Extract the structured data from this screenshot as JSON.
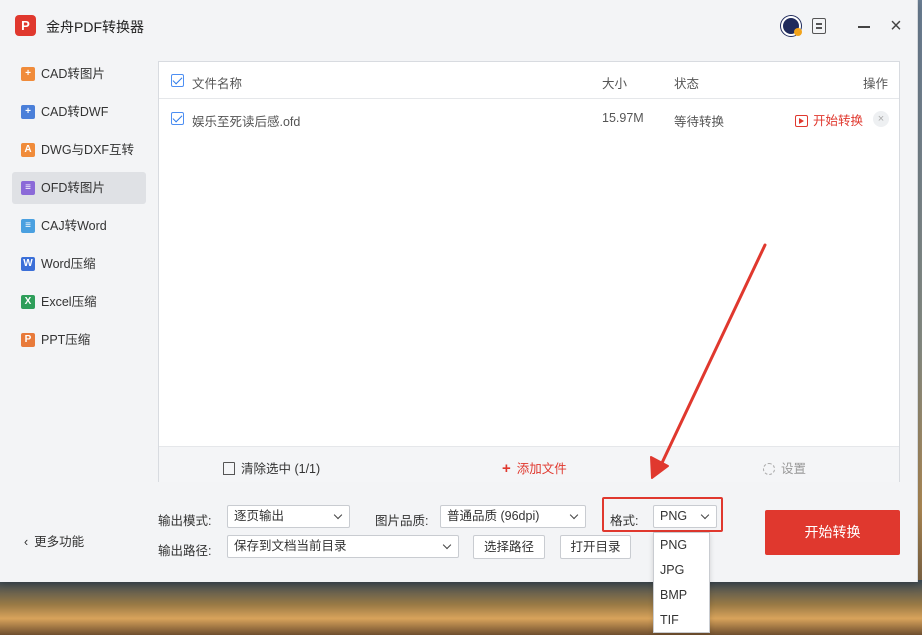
{
  "app": {
    "logo": "P",
    "title": "金舟PDF转换器"
  },
  "sidebar": {
    "items": [
      {
        "label": "CAD转图片",
        "icon": "cad-image-icon",
        "color": "#f08b3a",
        "glyph": "+"
      },
      {
        "label": "CAD转DWF",
        "icon": "cad-dwf-icon",
        "color": "#4a7fd9",
        "glyph": "+"
      },
      {
        "label": "DWG与DXF互转",
        "icon": "dwg-dxf-icon",
        "color": "#f08b3a",
        "glyph": "A"
      },
      {
        "label": "OFD转图片",
        "icon": "ofd-image-icon",
        "color": "#8b6ad8",
        "glyph": "≡"
      },
      {
        "label": "CAJ转Word",
        "icon": "caj-word-icon",
        "color": "#4aa0e0",
        "glyph": "≡"
      },
      {
        "label": "Word压缩",
        "icon": "word-compress-icon",
        "color": "#3b6fd8",
        "glyph": "W"
      },
      {
        "label": "Excel压缩",
        "icon": "excel-compress-icon",
        "color": "#2e9e5a",
        "glyph": "X"
      },
      {
        "label": "PPT压缩",
        "icon": "ppt-compress-icon",
        "color": "#e87a3a",
        "glyph": "P"
      }
    ],
    "more": "更多功能"
  },
  "table": {
    "headers": {
      "name": "文件名称",
      "size": "大小",
      "status": "状态",
      "action": "操作"
    },
    "rows": [
      {
        "name": "娱乐至死读后感.ofd",
        "size": "15.97M",
        "status": "等待转换",
        "action": "开始转换"
      }
    ]
  },
  "footer": {
    "clear": "清除选中 (1/1)",
    "add": "添加文件",
    "settings": "设置"
  },
  "options": {
    "output_mode_label": "输出模式:",
    "output_mode_value": "逐页输出",
    "quality_label": "图片品质:",
    "quality_value": "普通品质 (96dpi)",
    "format_label": "格式:",
    "format_value": "PNG",
    "path_label": "输出路径:",
    "path_value": "保存到文档当前目录",
    "choose_path": "选择路径",
    "open_dir": "打开目录",
    "start": "开始转换"
  },
  "format_options": [
    "PNG",
    "JPG",
    "BMP",
    "TIF"
  ]
}
